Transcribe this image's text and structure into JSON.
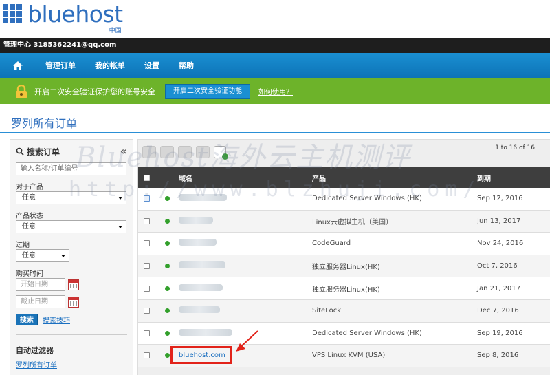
{
  "logo": {
    "word": "bluehost",
    "cn": "中国"
  },
  "account": {
    "text": "管理中心 3185362241@qq.com"
  },
  "nav": {
    "items": [
      "管理订单",
      "我的帐单",
      "设置",
      "帮助"
    ]
  },
  "banner": {
    "text": "开启二次安全验证保护您的账号安全",
    "button": "开启二次安全验证功能",
    "link": "如何使用？"
  },
  "page": {
    "title": "罗列所有订单"
  },
  "sidebar": {
    "title": "搜索订单",
    "search_placeholder": "输入名称/订单编号",
    "product_label": "对于产品",
    "product_value": "任意",
    "status_label": "产品状态",
    "status_value": "任意",
    "expire_label": "过期",
    "expire_value": "任意",
    "purchase_label": "购买时间",
    "start_placeholder": "开始日期",
    "end_placeholder": "截止日期",
    "search_button": "搜索",
    "tips_link": "搜索技巧",
    "auto_filter": "自动过滤器",
    "all_orders_link": "罗列所有订单"
  },
  "table": {
    "pager": "1 to 16 of 16",
    "headers": {
      "domain": "域名",
      "product": "产品",
      "expire": "到期"
    },
    "rows": [
      {
        "domain": "",
        "product": "Dedicated Server Windows (HK)",
        "expire": "Sep 12, 2016"
      },
      {
        "domain": "",
        "product": "Linux云虚拟主机（美国）",
        "expire": "Jun 13, 2017"
      },
      {
        "domain": "",
        "product": "CodeGuard",
        "expire": "Nov 24, 2016"
      },
      {
        "domain": "",
        "product": "独立服务器Linux(HK)",
        "expire": "Oct 7, 2016"
      },
      {
        "domain": "",
        "product": "独立服务器Linux(HK)",
        "expire": "Jan 21, 2017"
      },
      {
        "domain": "",
        "product": "SiteLock",
        "expire": "Dec 7, 2016"
      },
      {
        "domain": "",
        "product": "Dedicated Server Windows (HK)",
        "expire": "Sep 19, 2016"
      },
      {
        "domain": "bluehost.com",
        "product": "VPS Linux KVM (USA)",
        "expire": "Sep 8, 2016"
      }
    ]
  },
  "watermark": {
    "line1": "Bluehost海外云主机测评",
    "line2": "http://www.blzhuji.com/"
  },
  "colors": {
    "brand": "#2f6fbe",
    "nav": "#1a8fd2",
    "banner": "#6db32a",
    "highlight": "#e2231a"
  }
}
